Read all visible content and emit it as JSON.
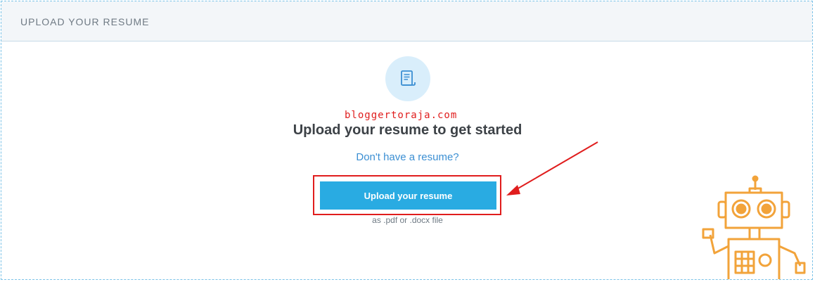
{
  "panel": {
    "title": "UPLOAD YOUR RESUME"
  },
  "main": {
    "icon": "document-icon",
    "watermark": "bloggertoraja.com",
    "heading": "Upload your resume to get started",
    "no_resume_link": "Don't have a resume?",
    "upload_button_label": "Upload your resume",
    "file_hint": "as .pdf or .docx file"
  },
  "colors": {
    "accent": "#29abe2",
    "link": "#3b8fd3",
    "annotation": "#e01d1d",
    "robot": "#f2a33a"
  }
}
